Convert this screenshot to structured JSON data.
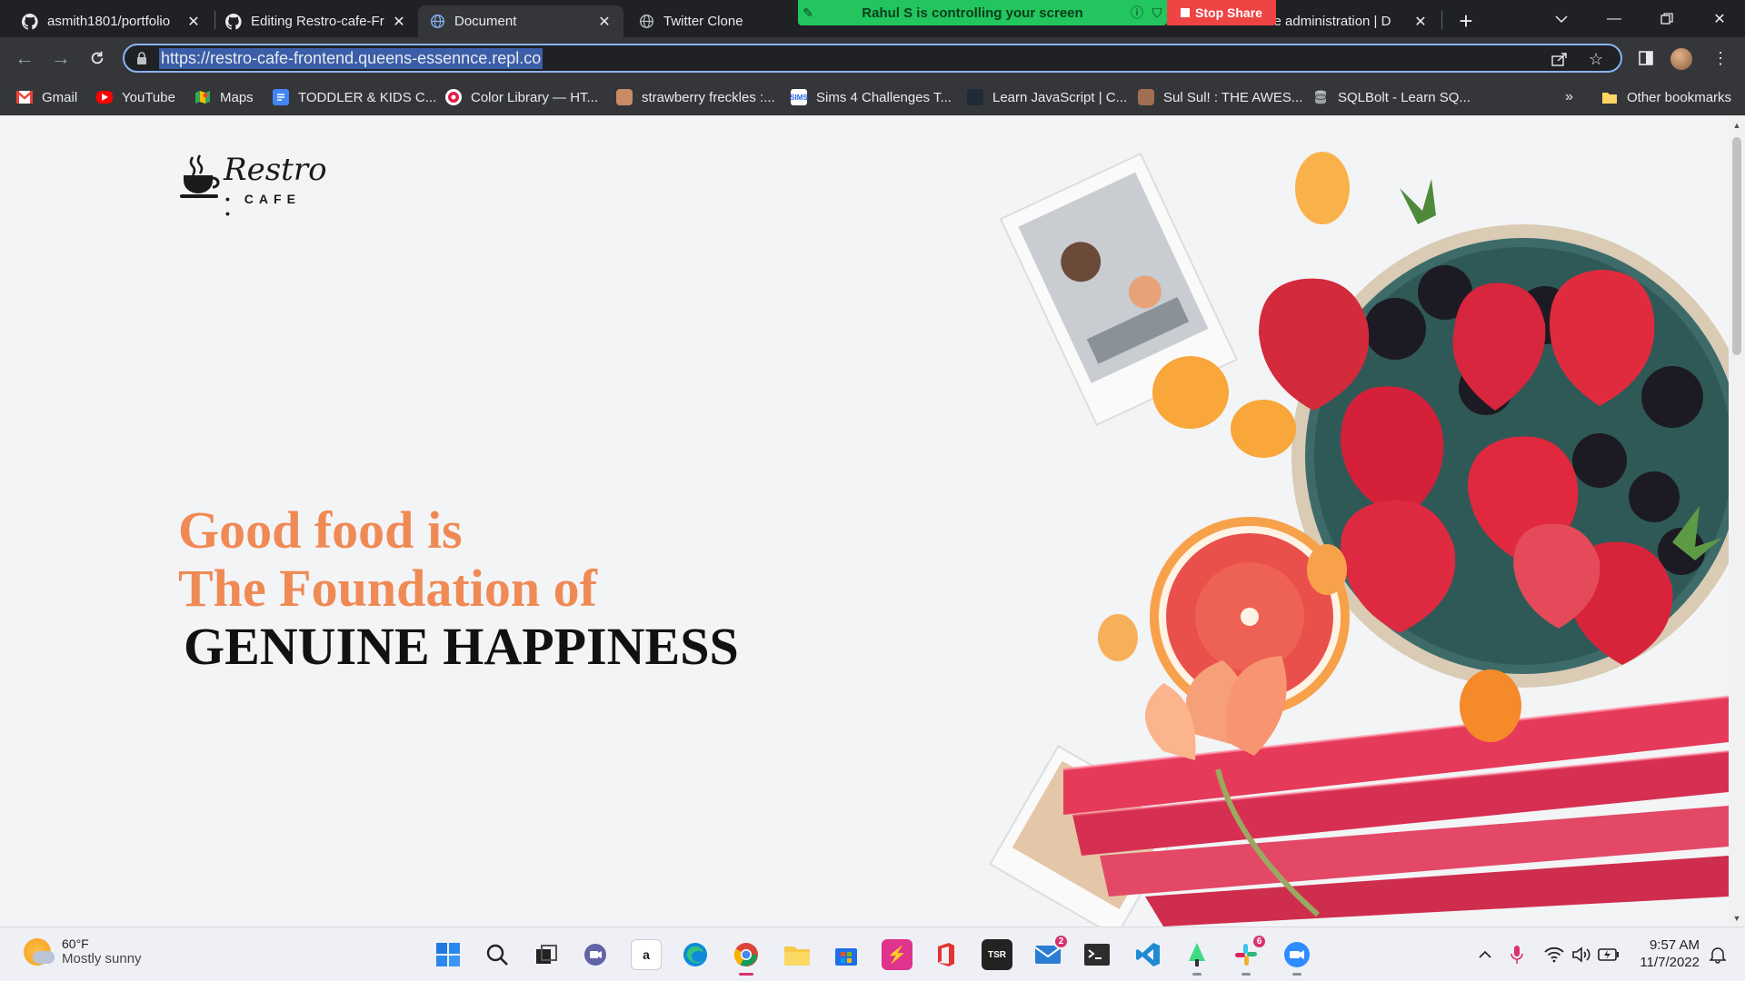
{
  "tabs": [
    {
      "title": "asmith1801/portfolio",
      "icon": "github-icon"
    },
    {
      "title": "Editing Restro-cafe-Fr",
      "icon": "github-icon"
    },
    {
      "title": "Document",
      "icon": "globe-icon"
    },
    {
      "title": "Twitter Clone",
      "icon": "globe-icon"
    },
    {
      "title": "Site administration | D",
      "icon": "globe-icon"
    }
  ],
  "screen_share": {
    "message": "Rahul S is controlling your screen",
    "stop_label": "Stop Share"
  },
  "address_bar": {
    "url": "https://restro-cafe-frontend.queens-essennce.repl.co"
  },
  "bookmarks": [
    {
      "label": "Gmail"
    },
    {
      "label": "YouTube"
    },
    {
      "label": "Maps"
    },
    {
      "label": "TODDLER & KIDS C..."
    },
    {
      "label": "Color Library — HT..."
    },
    {
      "label": "strawberry freckles :..."
    },
    {
      "label": "Sims 4 Challenges T..."
    },
    {
      "label": "Learn JavaScript | C..."
    },
    {
      "label": "Sul Sul! : THE AWES..."
    },
    {
      "label": "SQLBolt - Learn SQ..."
    }
  ],
  "bookmarks_overflow": "»",
  "other_bookmarks": "Other bookmarks",
  "site": {
    "logo_word": "Restro",
    "logo_sub": "• CAFE •",
    "hero": {
      "line1": "Good food is",
      "line2": "The Foundation of",
      "line3": "GENUINE HAPPINESS"
    },
    "colors": {
      "accent": "#f08a55",
      "text": "#111111",
      "background": "#f3f4f6"
    }
  },
  "taskbar": {
    "weather_temp": "60°F",
    "weather_condition": "Mostly sunny",
    "mail_badge": "2",
    "slack_badge": "6",
    "time": "9:57 AM",
    "date": "11/7/2022"
  }
}
